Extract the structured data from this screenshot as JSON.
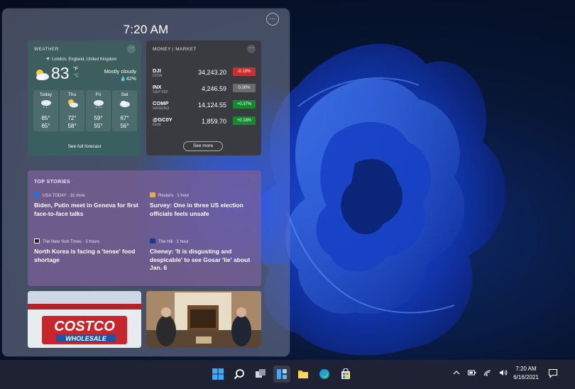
{
  "panel": {
    "time": "7:20 AM",
    "more_icon": "ellipsis-icon"
  },
  "weather": {
    "title": "WEATHER",
    "location": "London, England, United Kingdom",
    "temp": "83",
    "unit": "°F",
    "unit_alt": "°C",
    "condition": "Mostly cloudy",
    "precip": "42%",
    "forecast": [
      {
        "day": "Today",
        "hi": "85°",
        "lo": "65°",
        "icon": "rain-cloud-icon"
      },
      {
        "day": "Thu",
        "hi": "72°",
        "lo": "58°",
        "icon": "partly-sunny-icon"
      },
      {
        "day": "Fri",
        "hi": "59°",
        "lo": "55°",
        "icon": "rain-cloud-icon"
      },
      {
        "day": "Sat",
        "hi": "67°",
        "lo": "56°",
        "icon": "cloudy-icon"
      }
    ],
    "link": "See full forecast"
  },
  "money": {
    "title": "MONEY | MARKET",
    "stocks": [
      {
        "symbol": "DJI",
        "name": "DOW",
        "price": "34,243.20",
        "change": "-0.16%",
        "color": "#c7312f"
      },
      {
        "symbol": "INX",
        "name": "S&P 500",
        "price": "4,246.59",
        "change": "0.00%",
        "color": "#6b6b6e"
      },
      {
        "symbol": "COMP",
        "name": "NASDAQ",
        "price": "14,124.55",
        "change": "+0.37%",
        "color": "#138a2f"
      },
      {
        "symbol": "@GC0Y",
        "name": "Gold",
        "price": "1,859.70",
        "change": "+0.18%",
        "color": "#138a2f"
      }
    ],
    "see_more": "See more"
  },
  "stories": {
    "title": "TOP STORIES",
    "items": [
      {
        "source": "USA TODAY · 31 mins",
        "headline": "Biden, Putin meet in Geneva for first face-to-face talks",
        "logo_color": "#1a73e8"
      },
      {
        "source": "Reuters · 1 hour",
        "headline": "Survey: One in three US election officials feels unsafe",
        "logo_color": "#f2a93b"
      },
      {
        "source": "The New York Times · 3 hours",
        "headline": "North Korea is facing a 'tense' food shortage",
        "logo_color": "#222222"
      },
      {
        "source": "The Hill · 1 hour",
        "headline": "Cheney: 'It is disgusting and despicable' to see Gosar 'lie' about Jan. 6",
        "logo_color": "#1b3a8a"
      }
    ]
  },
  "news_images": {
    "costco_sign": "COSTCO",
    "costco_sub": "WHOLESALE"
  },
  "taskbar": {
    "time": "7:20 AM",
    "date": "6/16/2021"
  }
}
